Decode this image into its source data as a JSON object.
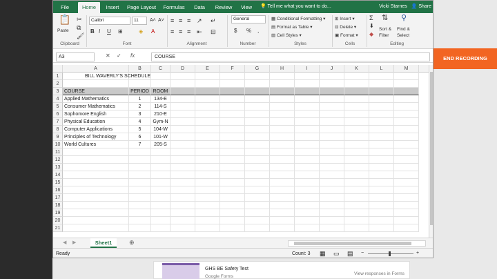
{
  "ribbon": {
    "tabs": [
      "File",
      "Home",
      "Insert",
      "Page Layout",
      "Formulas",
      "Data",
      "Review",
      "View"
    ],
    "active_tab": "Home",
    "tell_me": "Tell me what you want to do...",
    "user": "Vicki Starnes",
    "share": "Share",
    "clipboard": {
      "paste": "Paste",
      "label": "Clipboard"
    },
    "font": {
      "name": "Calibri",
      "size": "11",
      "label": "Font",
      "bold": "B",
      "italic": "I",
      "underline": "U"
    },
    "alignment": {
      "label": "Alignment"
    },
    "number": {
      "format": "General",
      "label": "Number",
      "currency": "$",
      "percent": "%",
      "comma": ","
    },
    "styles": {
      "conditional": "Conditional Formatting",
      "table": "Format as Table",
      "cell_styles": "Cell Styles",
      "label": "Styles"
    },
    "cells": {
      "insert": "Insert",
      "delete": "Delete",
      "format": "Format",
      "label": "Cells"
    },
    "editing": {
      "sort1": "Sort &",
      "sort2": "Filter",
      "find1": "Find &",
      "find2": "Select",
      "label": "Editing",
      "sigma": "Σ"
    }
  },
  "formula_bar": {
    "name_box": "A3",
    "fx": "fx",
    "value": "COURSE"
  },
  "columns": [
    "A",
    "B",
    "C",
    "D",
    "E",
    "F",
    "G",
    "H",
    "I",
    "J",
    "K",
    "L",
    "M"
  ],
  "rows": [
    "1",
    "2",
    "3",
    "4",
    "5",
    "6",
    "7",
    "8",
    "9",
    "10",
    "11",
    "12",
    "13",
    "14",
    "15",
    "16",
    "17",
    "18",
    "19",
    "20",
    "21"
  ],
  "sheet": {
    "title": "BILL WAVERLY'S SCHEDULE",
    "headers": [
      "COURSE",
      "PERIOD",
      "ROOM"
    ],
    "data": [
      [
        "Applied Mathematics",
        "1",
        "134-E"
      ],
      [
        "Consumer Mathematics",
        "2",
        "114-S"
      ],
      [
        "Sophomore English",
        "3",
        "210-E"
      ],
      [
        "Physical Education",
        "4",
        "Gym-N"
      ],
      [
        "Computer Applications",
        "5",
        "104-W"
      ],
      [
        "Principles of Technology",
        "6",
        "101-W"
      ],
      [
        "World Cultures",
        "7",
        "205-S"
      ]
    ]
  },
  "sheet_tabs": {
    "active": "Sheet1",
    "add": "⊕"
  },
  "status": {
    "ready": "Ready",
    "count": "Count: 3"
  },
  "overlay": {
    "end_recording": "END RECORDING"
  },
  "forms": {
    "title": "GHS BE Safety Test",
    "subtitle": "Google Forms",
    "responses": "View responses in Forms"
  },
  "colors": {
    "excel_green": "#217346",
    "header_fill": "#c9c9c9",
    "record_orange": "#f26522"
  }
}
